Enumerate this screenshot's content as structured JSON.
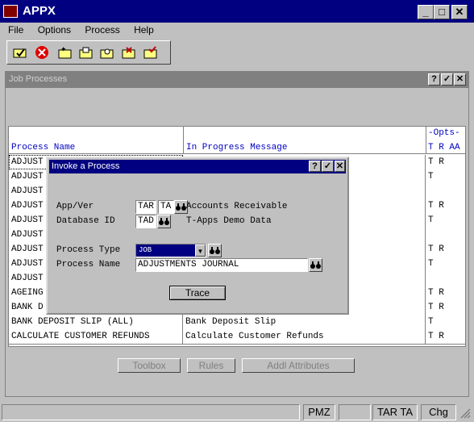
{
  "app": {
    "title": "APPX"
  },
  "menu": [
    "File",
    "Options",
    "Process",
    "Help"
  ],
  "toolbar": {
    "icons": [
      "check-folder-icon",
      "stop-icon",
      "folder-star-icon",
      "folder-open-icon",
      "folder-search-icon",
      "folder-delete-icon",
      "folder-check-icon"
    ]
  },
  "job_window": {
    "title": "Job Processes",
    "columns": {
      "process_name": "Process Name",
      "message": "In Progress Message",
      "opts": "-Opts-",
      "opts_sub": "T R AA"
    },
    "rows": [
      {
        "name": "ADJUST",
        "message": "",
        "opts": "T R"
      },
      {
        "name": "ADJUST",
        "message": "",
        "opts": "T"
      },
      {
        "name": "ADJUST",
        "message": "",
        "opts": ""
      },
      {
        "name": "ADJUST",
        "message": "",
        "opts": "T R"
      },
      {
        "name": "ADJUST",
        "message": "",
        "opts": "T"
      },
      {
        "name": "ADJUST",
        "message": "",
        "opts": ""
      },
      {
        "name": "ADJUST",
        "message": "",
        "opts": "T R"
      },
      {
        "name": "ADJUST",
        "message": "",
        "opts": "T"
      },
      {
        "name": "ADJUST",
        "message": "",
        "opts": ""
      },
      {
        "name": "AGEING",
        "message": "",
        "opts": "T R"
      },
      {
        "name": "BANK D",
        "message": "",
        "opts": "T R"
      },
      {
        "name": "BANK DEPOSIT SLIP (ALL)",
        "message": "Bank Deposit Slip",
        "opts": "T"
      },
      {
        "name": "CALCULATE CUSTOMER REFUNDS",
        "message": "Calculate Customer Refunds",
        "opts": "T R"
      }
    ],
    "buttons": {
      "toolbox": "Toolbox",
      "rules": "Rules",
      "attributes": "Addl Attributes"
    }
  },
  "dialog": {
    "title": "Invoke a Process",
    "app_ver_label": "App/Ver",
    "app_value": "TAR",
    "ver_value": "TA",
    "app_desc": "Accounts Receivable",
    "db_label": "Database ID",
    "db_value": "TAD",
    "db_desc": "T-Apps Demo Data",
    "ptype_label": "Process Type",
    "ptype_value": "JOB",
    "pname_label": "Process Name",
    "pname_value": "ADJUSTMENTS JOURNAL",
    "trace_label": "Trace"
  },
  "statusbar": {
    "s1": "",
    "s2": "PMZ",
    "s3": "",
    "s4": "TAR TA",
    "s5": "Chg"
  }
}
